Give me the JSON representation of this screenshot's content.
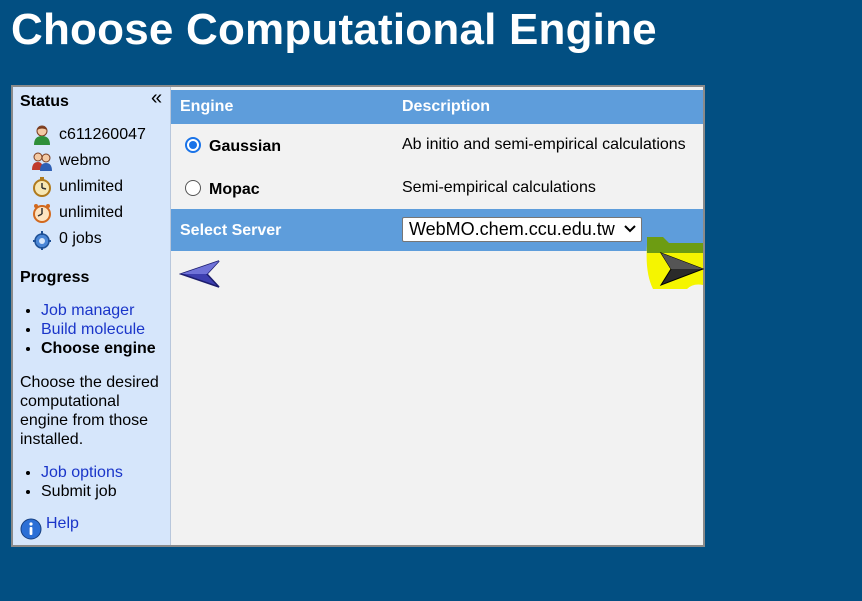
{
  "page": {
    "title": "Choose Computational Engine"
  },
  "sidebar": {
    "status_heading": "Status",
    "collapse_glyph": "«",
    "status_items": [
      {
        "icon": "user-icon",
        "text": "c611260047"
      },
      {
        "icon": "group-icon",
        "text": "webmo"
      },
      {
        "icon": "timer-icon",
        "text": "unlimited"
      },
      {
        "icon": "clock-icon",
        "text": "unlimited"
      },
      {
        "icon": "jobs-gear-icon",
        "text": "0 jobs"
      }
    ],
    "progress_heading": "Progress",
    "progress_steps": [
      {
        "label": "Job manager"
      },
      {
        "label": "Build molecule"
      },
      {
        "label": "Choose engine"
      }
    ],
    "description": "Choose the desired computational engine from those installed.",
    "next_steps": [
      {
        "label": "Job options"
      },
      {
        "label": "Submit job"
      }
    ],
    "help_label": "Help"
  },
  "table": {
    "engine_header": "Engine",
    "description_header": "Description",
    "engines": [
      {
        "name": "Gaussian",
        "description": "Ab initio and semi-empirical calculations",
        "selected": true
      },
      {
        "name": "Mopac",
        "description": "Semi-empirical calculations",
        "selected": false
      }
    ]
  },
  "server": {
    "label": "Select Server",
    "selected": "WebMO.chem.ccu.edu.tw"
  },
  "colors": {
    "page_bg": "#024f82",
    "header_bg": "#5e9ddb",
    "sidebar_bg": "#d6e6fb",
    "link": "#1a35c9",
    "next_highlight": "#f5f500"
  }
}
